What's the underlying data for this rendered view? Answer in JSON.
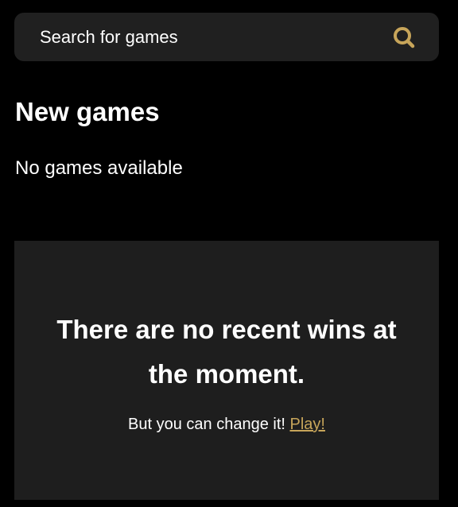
{
  "colors": {
    "background": "#000000",
    "surface": "#202020",
    "panel": "#1e1e1e",
    "accent": "#c7a55a",
    "text": "#ffffff"
  },
  "search": {
    "placeholder": "Search for games",
    "icon": "search-icon"
  },
  "new_games": {
    "title": "New games",
    "empty_message": "No games available"
  },
  "recent_wins": {
    "headline": "There are no recent wins at the moment.",
    "subtext": "But you can change it!",
    "play_link": "Play!"
  }
}
